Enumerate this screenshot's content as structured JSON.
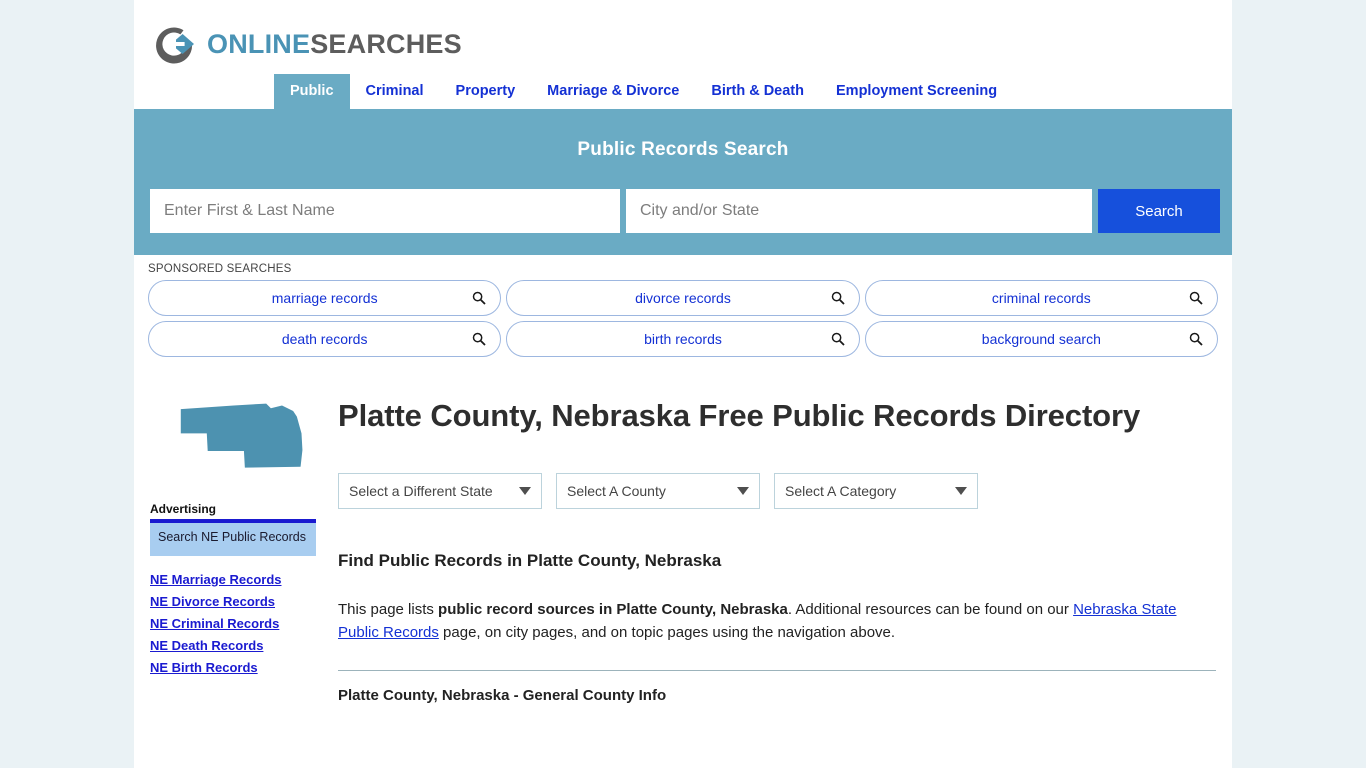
{
  "brand": {
    "logo_icon": "arrow-circle-icon",
    "name_part1": "ONLINE",
    "name_part2": "SEARCHES",
    "accent_color": "#4a93b5",
    "text_color": "#5d5d5d"
  },
  "nav": {
    "items": [
      {
        "label": "Public",
        "active": true
      },
      {
        "label": "Criminal",
        "active": false
      },
      {
        "label": "Property",
        "active": false
      },
      {
        "label": "Marriage & Divorce",
        "active": false
      },
      {
        "label": "Birth & Death",
        "active": false
      },
      {
        "label": "Employment Screening",
        "active": false
      }
    ],
    "active_bg": "#6aabc4",
    "link_color": "#1431d4"
  },
  "search": {
    "heading": "Public Records Search",
    "band_color": "#6aabc4",
    "name_placeholder": "Enter First & Last Name",
    "name_value": "",
    "city_placeholder": "City and/or State",
    "city_value": "",
    "button_label": "Search",
    "button_color": "#1650dc"
  },
  "sponsored": {
    "label": "SPONSORED SEARCHES",
    "icon": "magnifier-icon",
    "row1": [
      "marriage records",
      "divorce records",
      "criminal records"
    ],
    "row2": [
      "death records",
      "birth records",
      "background search"
    ]
  },
  "hero": {
    "map_icon": "nebraska-state-map",
    "map_color": "#4d92b0",
    "title": "Platte County, Nebraska Free Public Records Directory"
  },
  "selects": {
    "state": {
      "value": "Select a Different State"
    },
    "county": {
      "value": "Select A County"
    },
    "category": {
      "value": "Select A Category"
    }
  },
  "body": {
    "section_heading": "Find Public Records in Platte County, Nebraska",
    "intro_p1": "This page lists ",
    "intro_bold": "public record sources in Platte County, Nebraska",
    "intro_p2": ". Additional resources can be found on our ",
    "intro_link": "Nebraska State Public Records",
    "intro_p3": " page, on city pages, and on topic pages using the navigation above.",
    "next_section_title": "Platte County, Nebraska - General County Info"
  },
  "sidebar": {
    "advertising_label": "Advertising",
    "ad_title": "Search NE Public Records",
    "links": [
      "NE Marriage Records",
      "NE Divorce Records",
      "NE Criminal Records",
      "NE Death Records",
      "NE Birth Records"
    ]
  }
}
